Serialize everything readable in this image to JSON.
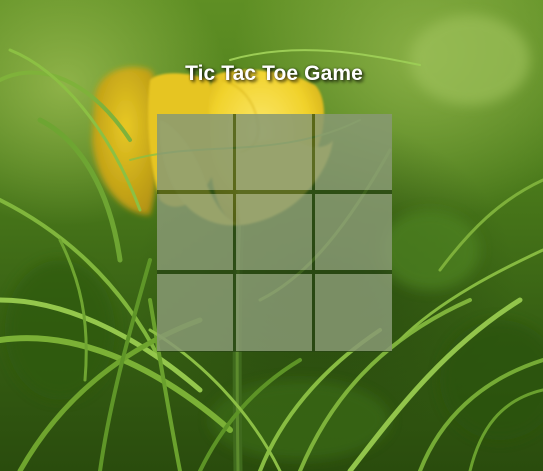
{
  "title": "Tic Tac Toe Game",
  "board": {
    "cells": [
      "",
      "",
      "",
      "",
      "",
      "",
      "",
      "",
      ""
    ]
  },
  "background": {
    "description_icon": "tulip-background-image",
    "colors": {
      "petal": "#f2d431",
      "grass_light": "#8fc040",
      "grass_dark": "#2c5610"
    }
  }
}
